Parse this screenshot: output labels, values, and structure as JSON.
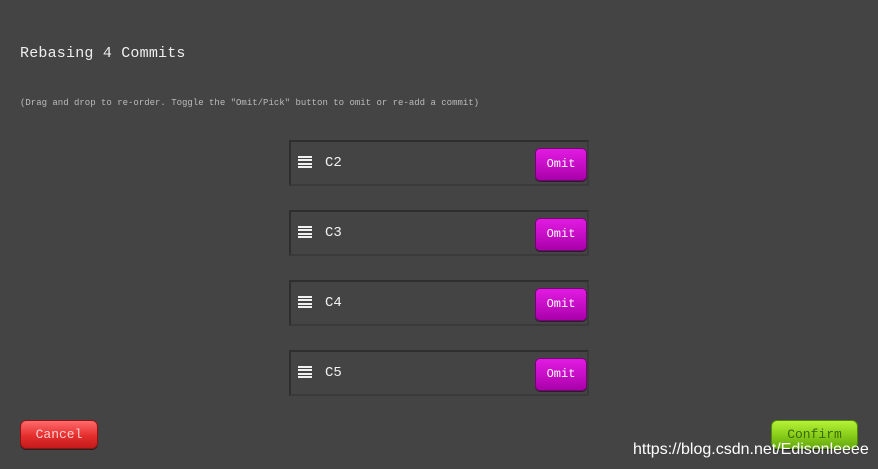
{
  "dialog": {
    "title": "Rebasing 4 Commits",
    "hint": "(Drag and drop to re-order. Toggle the \"Omit/Pick\" button to omit or re-add a commit)"
  },
  "commits": [
    {
      "id": "C2",
      "action_label": "Omit"
    },
    {
      "id": "C3",
      "action_label": "Omit"
    },
    {
      "id": "C4",
      "action_label": "Omit"
    },
    {
      "id": "C5",
      "action_label": "Omit"
    }
  ],
  "footer": {
    "cancel_label": "Cancel",
    "confirm_label": "Confirm"
  },
  "watermark": "https://blog.csdn.net/Edisonleeee",
  "icons": {
    "row_handle": "drag-handle-icon"
  },
  "colors": {
    "background": "#444444",
    "omit_button": "#c40dc4",
    "cancel_button": "#e52e2e",
    "confirm_button": "#86cc19"
  }
}
